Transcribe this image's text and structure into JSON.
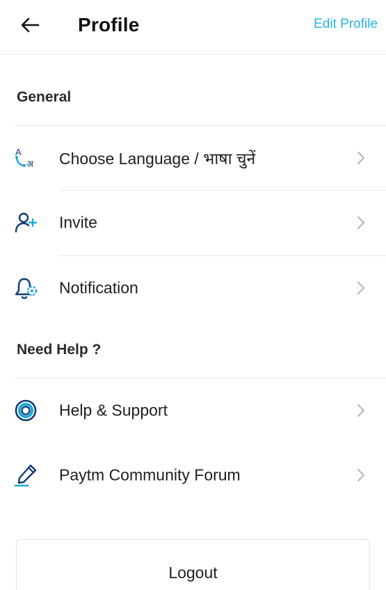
{
  "header": {
    "title": "Profile",
    "edit_label": "Edit Profile",
    "back_icon": "arrow-left-icon"
  },
  "colors": {
    "accent": "#27b5e6",
    "icon_primary": "#0f3b73",
    "icon_accent": "#1aa8e0",
    "divider": "#e6e6e6",
    "chevron": "#b8b8b8"
  },
  "sections": [
    {
      "title": "General",
      "items": [
        {
          "label": "Choose Language / भाषा चुनें",
          "icon": "language-translate-icon"
        },
        {
          "label": "Invite",
          "icon": "add-user-icon"
        },
        {
          "label": "Notification",
          "icon": "bell-settings-icon"
        }
      ]
    },
    {
      "title": "Need Help ?",
      "items": [
        {
          "label": "Help & Support",
          "icon": "lifebuoy-icon"
        },
        {
          "label": "Paytm Community Forum",
          "icon": "pen-icon"
        }
      ]
    }
  ],
  "logout": {
    "label": "Logout"
  }
}
